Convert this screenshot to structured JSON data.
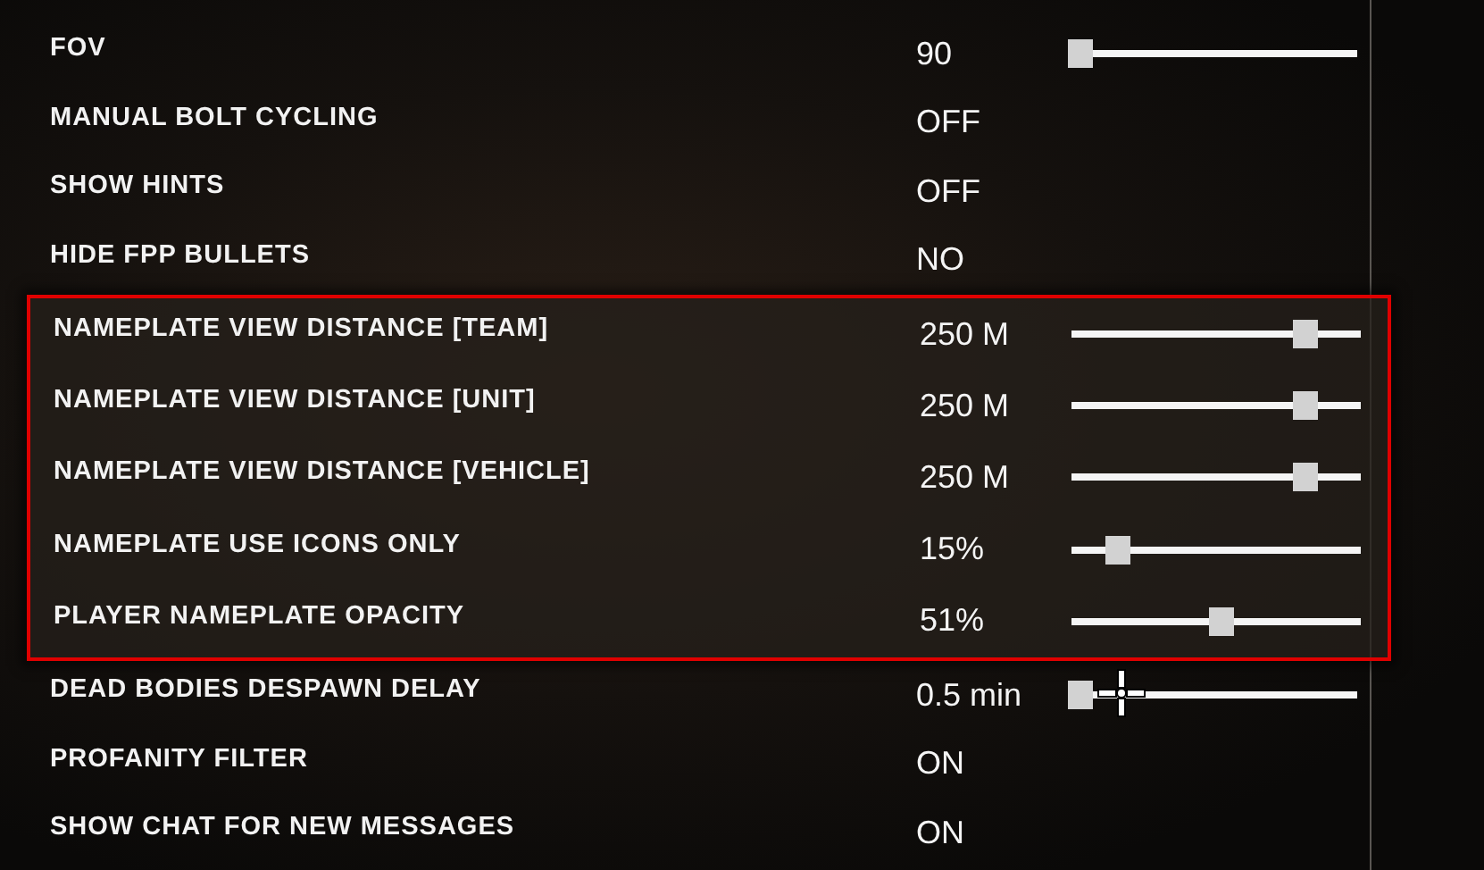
{
  "sections": [
    {
      "highlighted": false,
      "rows": [
        {
          "label": "FOV",
          "value": "90",
          "kind": "slider",
          "level": 0
        },
        {
          "label": "MANUAL BOLT CYCLING",
          "value": "OFF",
          "kind": "toggle"
        },
        {
          "label": "SHOW HINTS",
          "value": "OFF",
          "kind": "toggle"
        },
        {
          "label": "HIDE FPP BULLETS",
          "value": "NO",
          "kind": "toggle"
        }
      ]
    },
    {
      "highlighted": true,
      "rows": [
        {
          "label": "NAMEPLATE VIEW DISTANCE [TEAM]",
          "value": "250 M",
          "kind": "slider",
          "level": 0.84
        },
        {
          "label": "NAMEPLATE VIEW DISTANCE [UNIT]",
          "value": "250 M",
          "kind": "slider",
          "level": 0.84
        },
        {
          "label": "NAMEPLATE VIEW DISTANCE [VEHICLE]",
          "value": "250 M",
          "kind": "slider",
          "level": 0.84
        },
        {
          "label": "NAMEPLATE USE ICONS ONLY",
          "value": "15%",
          "kind": "slider",
          "level": 0.13
        },
        {
          "label": "PLAYER NAMEPLATE OPACITY",
          "value": "51%",
          "kind": "slider",
          "level": 0.52
        }
      ]
    },
    {
      "highlighted": false,
      "rows": [
        {
          "label": "DEAD BODIES DESPAWN DELAY",
          "value": "0.5 min",
          "kind": "slider",
          "level": 0
        },
        {
          "label": "PROFANITY FILTER",
          "value": "ON",
          "kind": "toggle"
        },
        {
          "label": "SHOW CHAT FOR NEW MESSAGES",
          "value": "ON",
          "kind": "toggle"
        }
      ]
    }
  ]
}
